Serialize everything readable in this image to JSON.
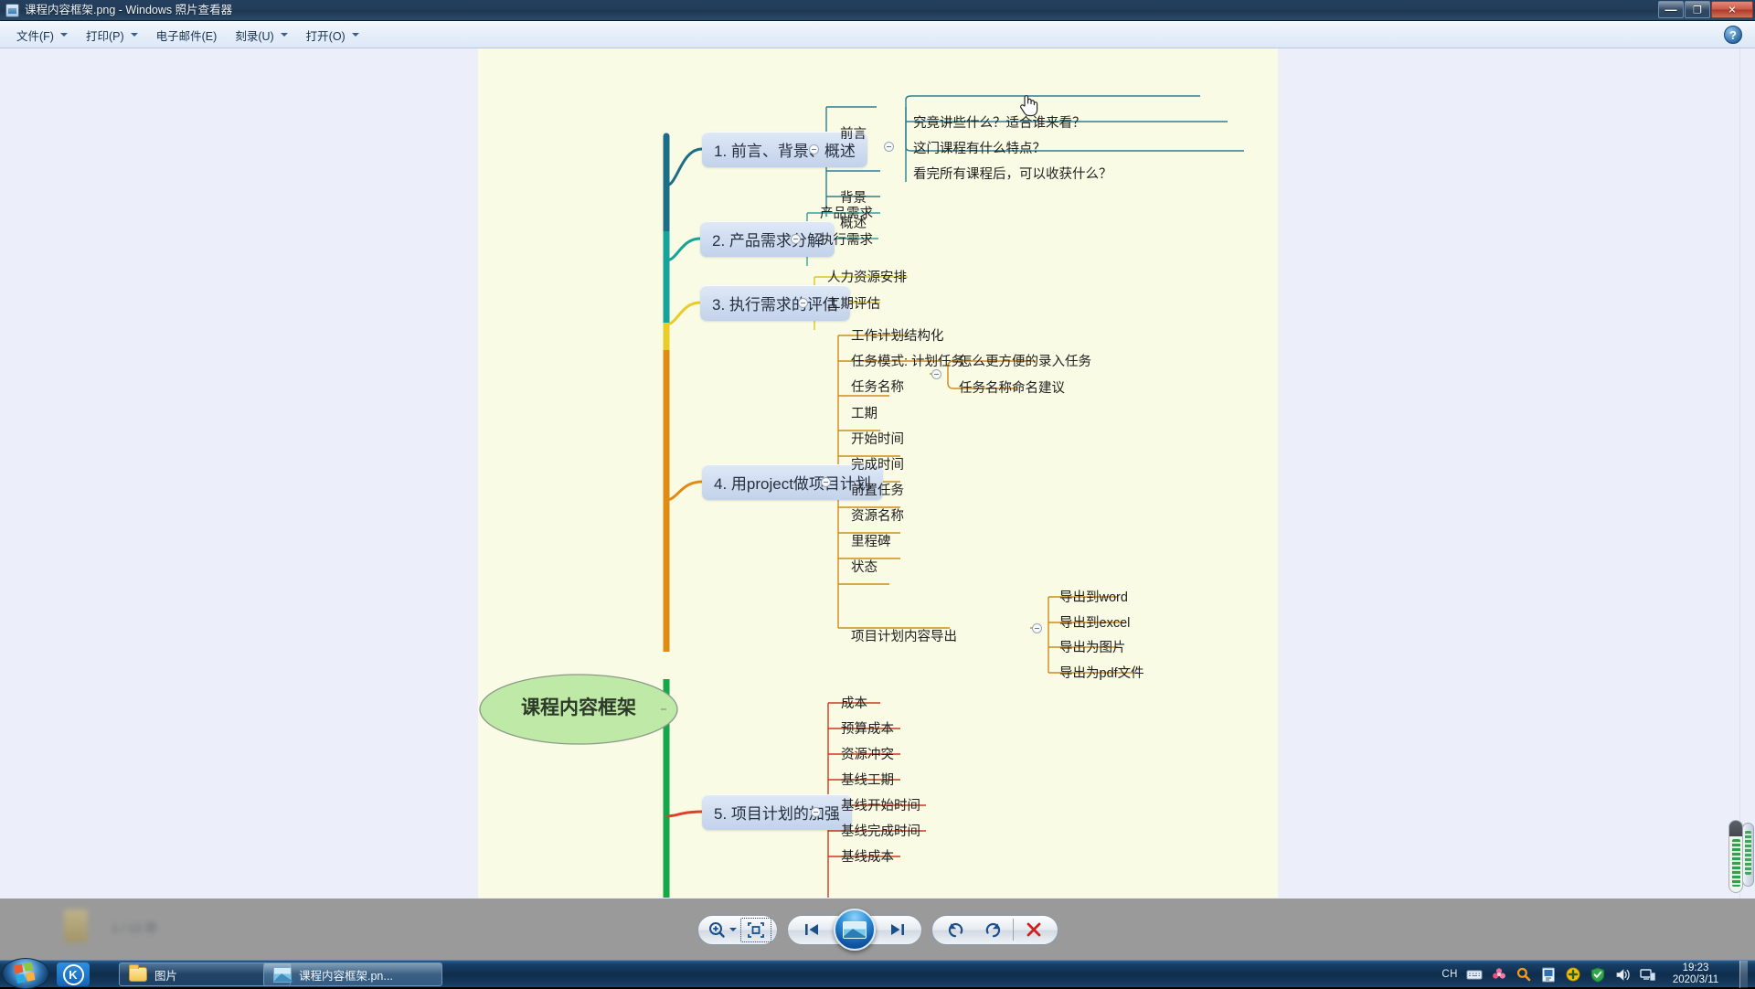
{
  "window": {
    "title": "课程内容框架.png - Windows 照片查看器",
    "icon": "photo-viewer-icon",
    "buttons": {
      "minimize": "—",
      "maximize": "❐",
      "close": "✕"
    }
  },
  "menubar": {
    "items": [
      {
        "label": "文件(F)",
        "has_caret": true
      },
      {
        "label": "打印(P)",
        "has_caret": true
      },
      {
        "label": "电子邮件(E)",
        "has_caret": false
      },
      {
        "label": "刻录(U)",
        "has_caret": true
      },
      {
        "label": "打开(O)",
        "has_caret": true
      }
    ],
    "help_label": "?"
  },
  "toolbar": {
    "buttons": [
      {
        "name": "zoom-button",
        "label": ""
      },
      {
        "name": "actual-size-button",
        "label": ""
      },
      {
        "name": "previous-button",
        "label": ""
      },
      {
        "name": "slideshow-button",
        "label": ""
      },
      {
        "name": "next-button",
        "label": ""
      },
      {
        "name": "rotate-left-button",
        "label": ""
      },
      {
        "name": "rotate-right-button",
        "label": ""
      },
      {
        "name": "delete-button",
        "label": ""
      }
    ]
  },
  "status": {
    "blurred_text": "1 / 13 项"
  },
  "taskbar": {
    "start_label": "",
    "quick_launch": {
      "label": "K"
    },
    "tasks": [
      {
        "name": "task-pictures",
        "label": "图片",
        "icon": "folder-icon",
        "active": false
      },
      {
        "name": "task-photo-viewer",
        "label": "课程内容框架.pn...",
        "icon": "photo-icon",
        "active": true
      }
    ],
    "tray": {
      "ime": "CH",
      "icons": [
        "keyboard-icon",
        "flower-icon",
        "search-icon",
        "document-icon",
        "update-icon",
        "shield-icon",
        "speaker-icon",
        "network-icon"
      ],
      "time": "19:23",
      "date": "2020/3/11"
    }
  },
  "mindmap": {
    "root": {
      "label": "课程内容框架",
      "fill": "#b7e8a2",
      "stroke": "#7d8f7a"
    },
    "branches": [
      {
        "label": "1. 前言、背景、概述",
        "color": "#1c6d86",
        "children": [
          {
            "label": "前言",
            "children": [
              {
                "label": "究竟讲些什么？适合谁来看？"
              },
              {
                "label": "这门课程有什么特点？"
              },
              {
                "label": "看完所有课程后，可以收获什么？"
              }
            ]
          },
          {
            "label": "背景",
            "children": []
          },
          {
            "label": "概述",
            "children": []
          }
        ]
      },
      {
        "label": "2. 产品需求分解",
        "color": "#16a39a",
        "children": [
          {
            "label": "产品需求",
            "children": []
          },
          {
            "label": "执行需求",
            "children": []
          }
        ]
      },
      {
        "label": "3. 执行需求的评估",
        "color": "#e8cc2a",
        "children": [
          {
            "label": "人力资源安排",
            "children": []
          },
          {
            "label": "工期评估",
            "children": []
          }
        ]
      },
      {
        "label": "4. 用project做项目计划",
        "color": "#e08c14",
        "children": [
          {
            "label": "工作计划结构化",
            "children": []
          },
          {
            "label": "任务模式: 计划任务",
            "children": []
          },
          {
            "label": "任务名称",
            "children": [
              {
                "label": "怎么更方便的录入任务"
              },
              {
                "label": "任务名称命名建议"
              }
            ]
          },
          {
            "label": "工期",
            "children": []
          },
          {
            "label": "开始时间",
            "children": []
          },
          {
            "label": "完成时间",
            "children": []
          },
          {
            "label": "前置任务",
            "children": []
          },
          {
            "label": "资源名称",
            "children": []
          },
          {
            "label": "里程碑",
            "children": []
          },
          {
            "label": "状态",
            "children": []
          },
          {
            "label": "项目计划内容导出",
            "children": [
              {
                "label": "导出到word"
              },
              {
                "label": "导出到excel"
              },
              {
                "label": "导出为图片"
              },
              {
                "label": "导出为pdf文件"
              }
            ]
          }
        ]
      },
      {
        "label": "5. 项目计划的加强",
        "color": "#e0402a",
        "children": [
          {
            "label": "成本",
            "children": []
          },
          {
            "label": "预算成本",
            "children": []
          },
          {
            "label": "资源冲突",
            "children": []
          },
          {
            "label": "基线工期",
            "children": []
          },
          {
            "label": "基线开始时间",
            "children": []
          },
          {
            "label": "基线完成时间",
            "children": []
          },
          {
            "label": "基线成本",
            "children": []
          }
        ]
      }
    ]
  },
  "colors": {
    "canvas_bg": "#f9fbe4",
    "viewer_bg": "#eceff9",
    "titlebar": "#223c59",
    "taskbar": "#12304f"
  }
}
